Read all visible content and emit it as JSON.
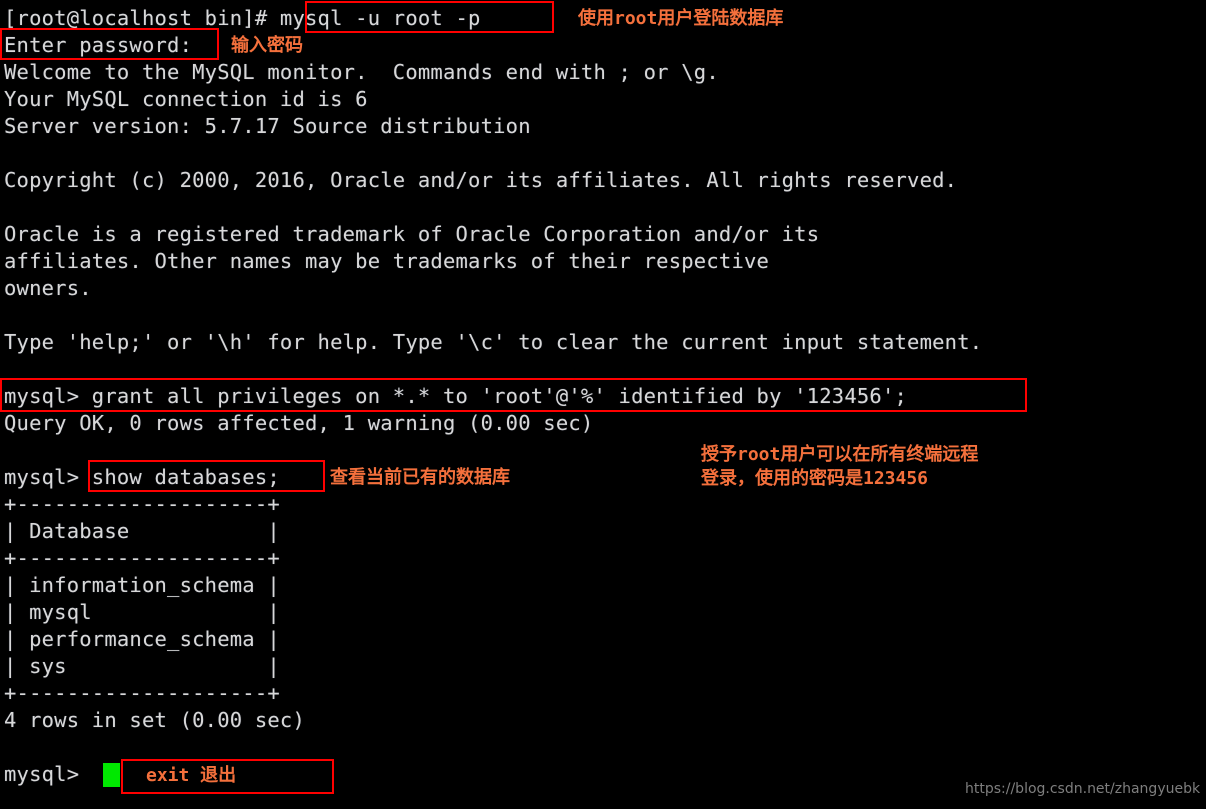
{
  "terminal": {
    "background_color": "#000000",
    "text_color": "#d8d8d8",
    "annotation_color": "#f4703c",
    "highlight_color": "#ff0000",
    "cursor_color": "#00e800",
    "lines": [
      "[root@localhost bin]# mysql -u root -p",
      "Enter password:",
      "Welcome to the MySQL monitor.  Commands end with ; or \\g.",
      "Your MySQL connection id is 6",
      "Server version: 5.7.17 Source distribution",
      "",
      "Copyright (c) 2000, 2016, Oracle and/or its affiliates. All rights reserved.",
      "",
      "Oracle is a registered trademark of Oracle Corporation and/or its",
      "affiliates. Other names may be trademarks of their respective",
      "owners.",
      "",
      "Type 'help;' or '\\h' for help. Type '\\c' to clear the current input statement.",
      "",
      "mysql> grant all privileges on *.* to 'root'@'%' identified by '123456';",
      "Query OK, 0 rows affected, 1 warning (0.00 sec)",
      "",
      "mysql> show databases;",
      "+--------------------+",
      "| Database           |",
      "+--------------------+",
      "| information_schema |",
      "| mysql              |",
      "| performance_schema |",
      "| sys                |",
      "+--------------------+",
      "4 rows in set (0.00 sec)",
      "",
      "mysql>"
    ]
  },
  "annotations": {
    "login_db": "使用root用户登陆数据库",
    "enter_password": "输入密码",
    "grant_privileges_line1": "授予root用户可以在所有终端远程",
    "grant_privileges_line2": "登录，使用的密码是123456",
    "show_databases": "查看当前已有的数据库",
    "exit_command": "exit 退出"
  },
  "watermark": {
    "url": "https://blog.csdn.net/zhangyuebk"
  },
  "database_table": {
    "header": "Database",
    "rows": [
      "information_schema",
      "mysql",
      "performance_schema",
      "sys"
    ],
    "row_count_text": "4 rows in set (0.00 sec)"
  },
  "commands": {
    "login": "mysql -u root -p",
    "grant": "grant all privileges on *.* to 'root'@'%' identified by '123456';",
    "show": "show databases;",
    "exit": "exit"
  }
}
